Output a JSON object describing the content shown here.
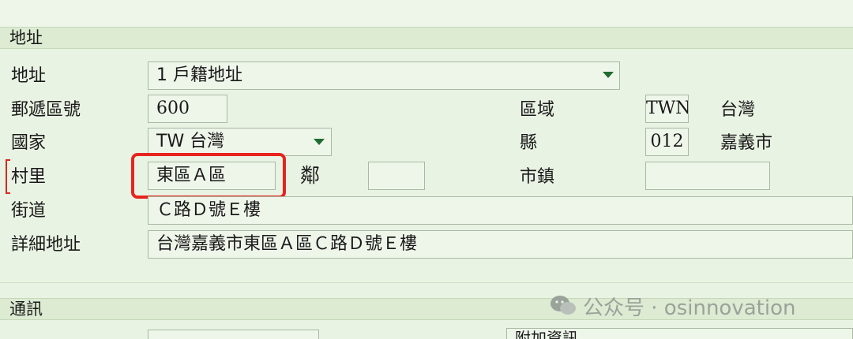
{
  "section_address": {
    "title": "地址"
  },
  "address": {
    "type_label": "地址",
    "type_value": "1 戶籍地址",
    "postal_label": "郵遞區號",
    "postal_value": "600",
    "region_label": "區域",
    "region_code": "TWN",
    "region_name": "台灣",
    "country_label": "國家",
    "country_value": "TW 台灣",
    "county_label": "縣",
    "county_code": "012",
    "county_name": "嘉義市",
    "village_label": "村里",
    "village_value": "東區Ａ區",
    "neighborhood_label": "鄰",
    "neighborhood_value": "",
    "town_label": "市鎮",
    "town_value": "",
    "street_label": "街道",
    "street_value": "Ｃ路Ｄ號Ｅ樓",
    "detail_label": "詳細地址",
    "detail_value": "台灣嘉義市東區Ａ區Ｃ路Ｄ號Ｅ樓"
  },
  "section_contact": {
    "title": "通訊",
    "extra_label": "附加資訊"
  },
  "watermark": {
    "text": "公众号 · osinnovation"
  },
  "colors": {
    "highlight": "#e8231d",
    "caret": "#1f6b30"
  }
}
